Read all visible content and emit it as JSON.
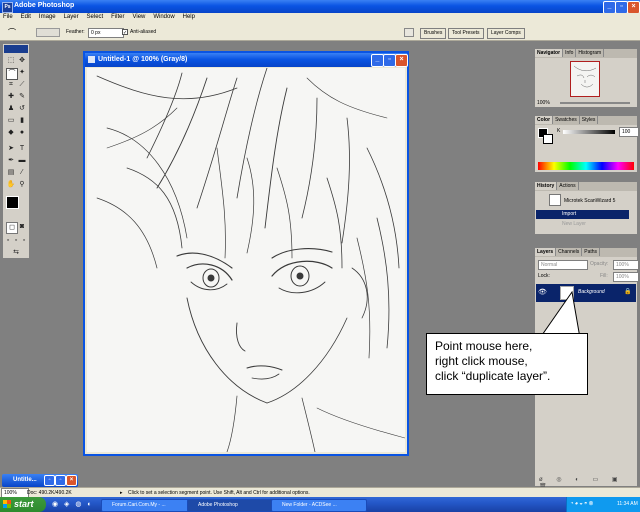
{
  "app": {
    "title": "Adobe Photoshop"
  },
  "menu": [
    "File",
    "Edit",
    "Image",
    "Layer",
    "Select",
    "Filter",
    "View",
    "Window",
    "Help"
  ],
  "options": {
    "feather_label": "Feather:",
    "feather_value": "0 px",
    "antialiased_label": "Anti-aliased",
    "tabs": [
      "Brushes",
      "Tool Presets",
      "Layer Comps"
    ]
  },
  "document": {
    "title": "Untitled-1 @ 100% (Gray/8)"
  },
  "minimized_doc": {
    "title": "Untitle..."
  },
  "navigator": {
    "tabs": [
      "Navigator",
      "Info",
      "Histogram"
    ],
    "zoom": "100%"
  },
  "color": {
    "tabs": [
      "Color",
      "Swatches",
      "Styles"
    ],
    "channel": "K",
    "value": "100"
  },
  "history": {
    "tabs": [
      "History",
      "Actions"
    ],
    "snapshot": "Microtek ScanWizard 5",
    "items": [
      "Import",
      "New Layer"
    ]
  },
  "layers": {
    "tabs": [
      "Layers",
      "Channels",
      "Paths"
    ],
    "blend": "Normal",
    "opacity_label": "Opacity:",
    "opacity": "100%",
    "lock_label": "Lock:",
    "fill_label": "Fill:",
    "fill": "100%",
    "layer_name": "Background"
  },
  "callout": {
    "line1": "Point mouse here,",
    "line2": "right click mouse,",
    "line3": "click “duplicate layer”."
  },
  "status": {
    "zoom": "100%",
    "doc": "Doc: 490.2K/490.2K",
    "hint": "Click to set a selection segment point. Use Shift, Alt and Ctrl for additional options."
  },
  "taskbar": {
    "start": "start",
    "tasks": [
      "Forum.Cari.Com.My - ...",
      "Adobe Photoshop",
      "New Folder - ACDSee ..."
    ],
    "clock": "11:34 AM"
  },
  "colors": {
    "xp_blue": "#0a54e3",
    "panel": "#d4d0c8",
    "workspace": "#808080"
  }
}
